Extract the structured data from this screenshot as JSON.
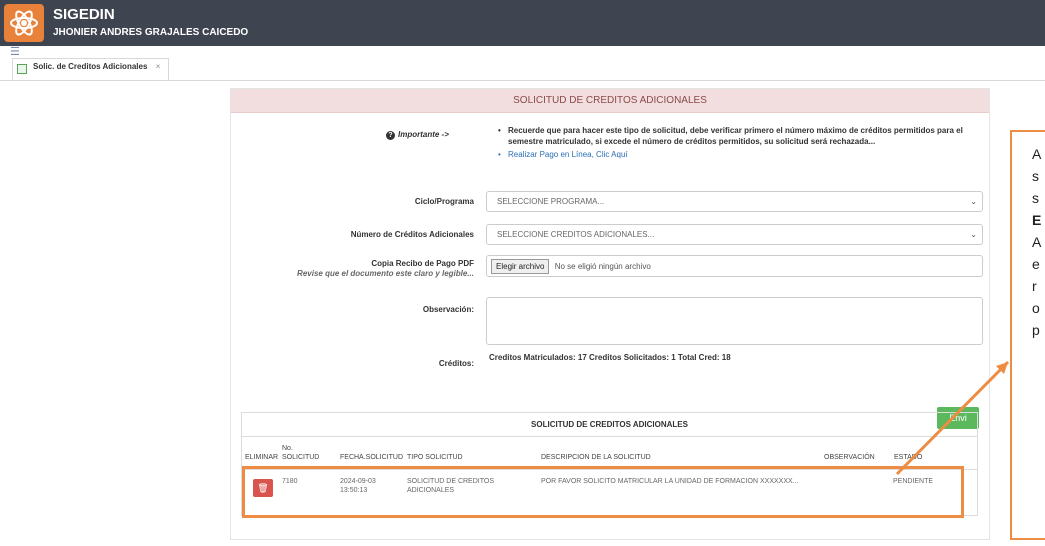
{
  "header": {
    "app_title": "SIGEDIN",
    "user_name": "JHONIER ANDRES GRAJALES CAICEDO"
  },
  "tab": {
    "label": "Solic. de Creditos Adicionales",
    "close": "×"
  },
  "form": {
    "title": "SOLICITUD DE CREDITOS ADICIONALES",
    "important_label": "Importante ->",
    "important_text": "Recuerde que para hacer este tipo de solicitud, debe verificar primero el número máximo de créditos permitidos para el semestre matriculado, si excede el número de créditos permitidos, su solicitud será rechazada...",
    "payment_link": "Realizar Pago en Línea, Clic Aquí",
    "ciclo_label": "Ciclo/Programa",
    "ciclo_value": "SELECCIONE PROGRAMA...",
    "num_creditos_label": "Número de Créditos Adicionales",
    "num_creditos_value": "SELECCIONE CREDITOS ADICIONALES...",
    "recibo_label": "Copia Recibo de Pago PDF",
    "recibo_hint": "Revise que el documento este claro y legible...",
    "file_button": "Elegir archivo",
    "file_status": "No se eligió ningún archivo",
    "observacion_label": "Observación:",
    "creditos_label": "Créditos:",
    "creditos_text": "Creditos Matriculados: 17 Creditos Solicitados: 1 Total Cred: 18",
    "submit_label": "Envi"
  },
  "table": {
    "title": "SOLICITUD DE CREDITOS ADICIONALES",
    "headers": [
      "ELIMINAR",
      "No. SOLICITUD",
      "FECHA.SOLICITUD",
      "TIPO SOLICITUD",
      "DESCRIPCION DE LA SOLICITUD",
      "OBSERVACIÓN",
      "ESTADO"
    ],
    "rows": [
      {
        "numero": "7180",
        "fecha": "2024-09-03 13:50:13",
        "tipo": "SOLICITUD DE CREDITOS ADICIONALES",
        "descripcion": "POR FAVOR SOLICITO MATRICULAR LA UNIDAD DE FORMACION XXXXXXX...",
        "observacion": "",
        "estado": "PENDIENTE"
      }
    ]
  },
  "callout": {
    "letters": [
      "A",
      "s",
      "s",
      "E",
      "A",
      "e",
      "r",
      "o",
      "p"
    ]
  },
  "colors": {
    "topbar": "#3f4550",
    "accent_orange": "#ed8c42",
    "header_pink": "#f2dede",
    "delete_red": "#d9534f",
    "submit_green": "#5cb85c"
  }
}
